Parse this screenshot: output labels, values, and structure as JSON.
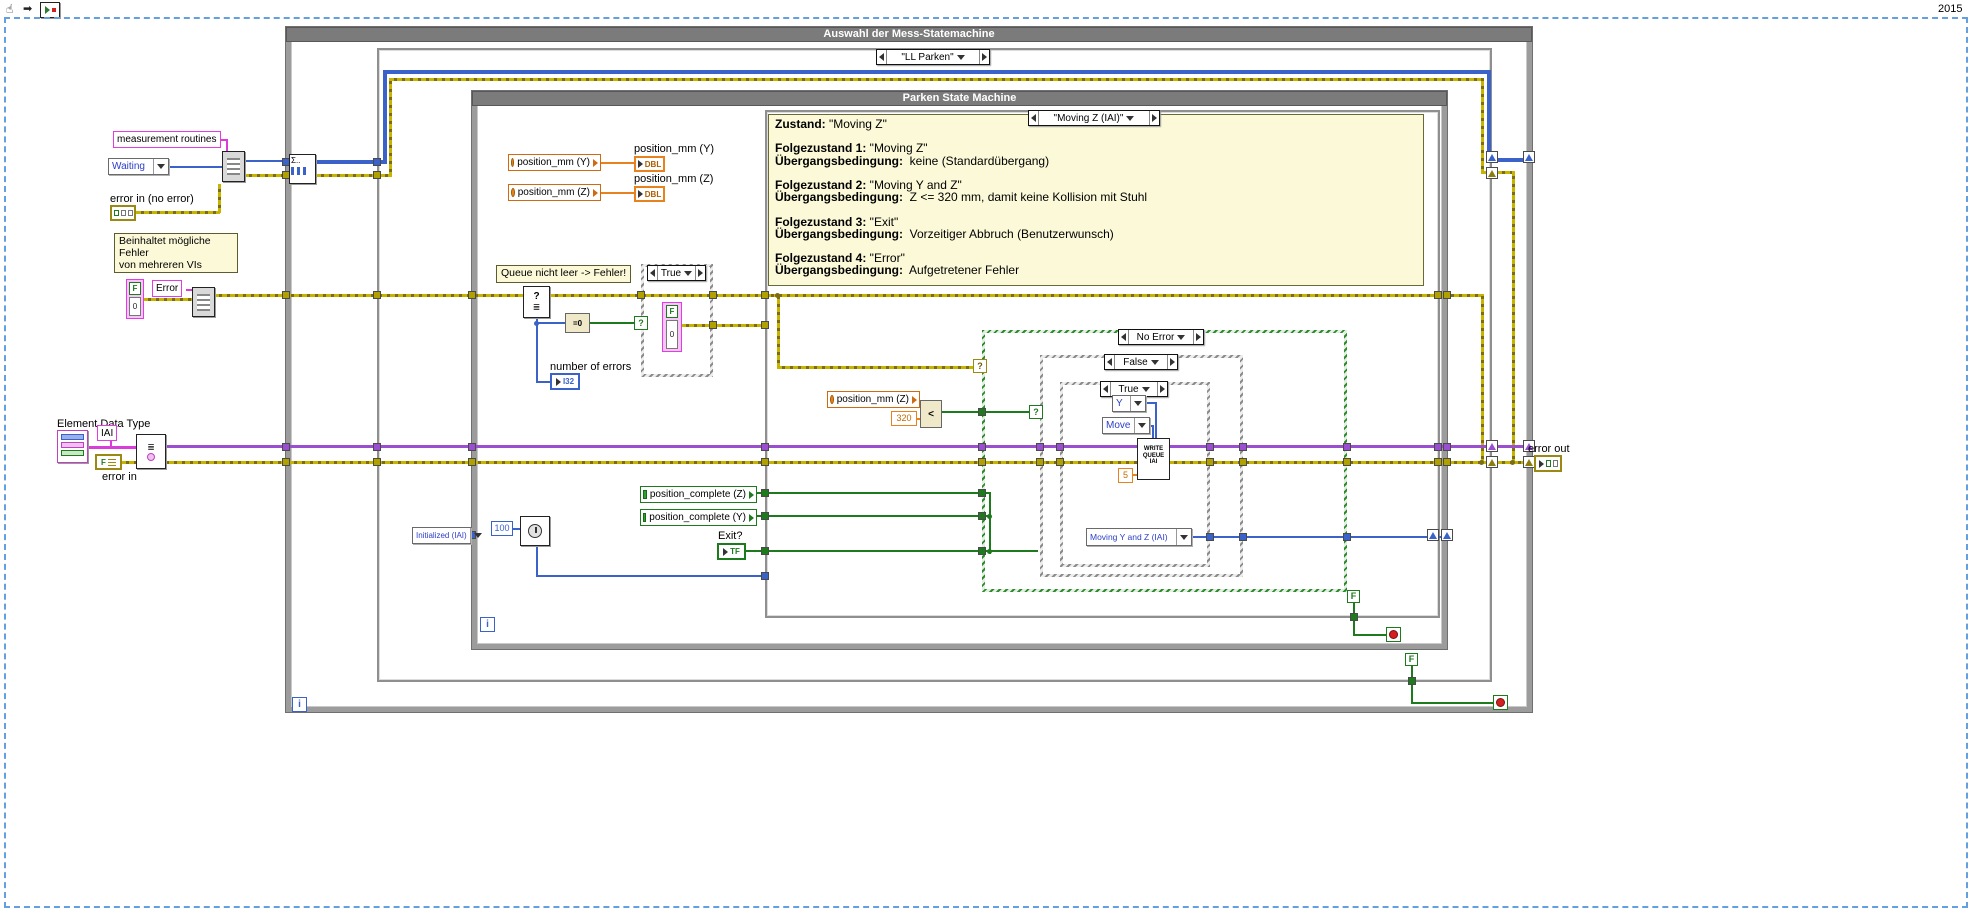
{
  "year": "2015",
  "icons": {
    "hand": "☝",
    "nav_arrow": "➡"
  },
  "outer_loop": {
    "title": "Auswahl der Mess-Statemachine"
  },
  "inner_loop": {
    "title": "Parken State Machine"
  },
  "selectors": {
    "main": "\"LL Parken\"",
    "state": "\"Moving Z (IAI)\"",
    "queue_check": "True",
    "no_error": "No Error",
    "false_inner": "False",
    "true_inner": "True"
  },
  "comment": {
    "lines": [
      {
        "b": "Zustand:",
        "t": " \"Moving Z\""
      },
      {
        "b": "",
        "t": ""
      },
      {
        "b": "Folgezustand 1:",
        "t": " \"Moving Z\""
      },
      {
        "b": "Übergangsbedingung:",
        "t": "  keine (Standardübergang)"
      },
      {
        "b": "",
        "t": ""
      },
      {
        "b": "Folgezustand 2:",
        "t": " \"Moving Y and Z\""
      },
      {
        "b": "Übergangsbedingung:",
        "t": "  Z <= 320 mm, damit keine Kollision mit Stuhl"
      },
      {
        "b": "",
        "t": ""
      },
      {
        "b": "Folgezustand 3:",
        "t": " \"Exit\""
      },
      {
        "b": "Übergangsbedingung:",
        "t": "  Vorzeitiger Abbruch (Benutzerwunsch)"
      },
      {
        "b": "",
        "t": ""
      },
      {
        "b": "Folgezustand 4:",
        "t": " \"Error\""
      },
      {
        "b": "Übergangsbedingung:",
        "t": "  Aufgetretener Fehler"
      }
    ]
  },
  "labels": {
    "measurement_routines": "measurement routines",
    "waiting": "Waiting",
    "error_in_no_error": "error in (no error)",
    "hint": "Beinhaltet mögliche Fehler\nvon mehreren VIs",
    "error": "Error",
    "element_data_type": "Element Data Type",
    "iai": "IAI",
    "error_in": "error in",
    "queue_hint": "Queue nicht leer -> Fehler!",
    "number_of_errors": "number of errors",
    "position_mm_y": "position_mm (Y)",
    "position_mm_z": "position_mm (Z)",
    "position_complete_z": "position_complete (Z)",
    "position_complete_y": "position_complete (Y)",
    "initialized": "Initialized (IAI)",
    "c100": "100",
    "exit": "Exit?",
    "c320": "320",
    "y": "Y",
    "move": "Move",
    "write_queue": "WRITE\nQUEUE\nIAI",
    "c5": "5",
    "moving": "Moving Y and Z (IAI)",
    "error_out": "error out",
    "i": "i",
    "f": "F",
    "dbl": "DBL",
    "i32": "I32",
    "tf": "TF",
    "zero": "0",
    "eq0": "=0",
    "less": "<",
    "q": "?",
    "sigma": "Σ..",
    "rows": "≣"
  }
}
